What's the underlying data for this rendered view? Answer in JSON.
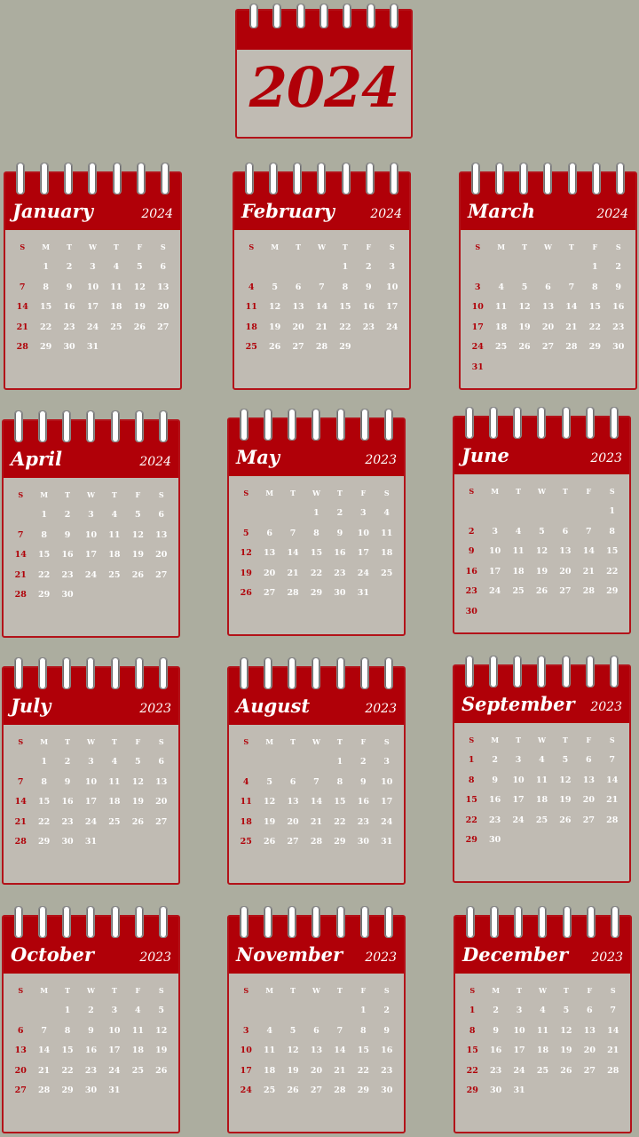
{
  "header": {
    "year": "2024"
  },
  "weekdays": [
    "S",
    "M",
    "T",
    "W",
    "T",
    "F",
    "S"
  ],
  "colors": {
    "background": "#acad9f",
    "accent": "#b00008",
    "page": "#c0bbb3",
    "rings": "#ffffff"
  },
  "months": [
    {
      "name": "January",
      "year": "2024",
      "start": 1,
      "days": 31
    },
    {
      "name": "February",
      "year": "2024",
      "start": 4,
      "days": 29
    },
    {
      "name": "March",
      "year": "2024",
      "start": 5,
      "days": 31
    },
    {
      "name": "April",
      "year": "2024",
      "start": 1,
      "days": 30
    },
    {
      "name": "May",
      "year": "2023",
      "start": 3,
      "days": 31
    },
    {
      "name": "June",
      "year": "2023",
      "start": 6,
      "days": 30
    },
    {
      "name": "July",
      "year": "2023",
      "start": 1,
      "days": 31
    },
    {
      "name": "August",
      "year": "2023",
      "start": 4,
      "days": 31
    },
    {
      "name": "September",
      "year": "2023",
      "start": 0,
      "days": 30
    },
    {
      "name": "October",
      "year": "2023",
      "start": 2,
      "days": 31
    },
    {
      "name": "November",
      "year": "2023",
      "start": 5,
      "days": 30
    },
    {
      "name": "December",
      "year": "2023",
      "start": 0,
      "days": 31
    }
  ]
}
